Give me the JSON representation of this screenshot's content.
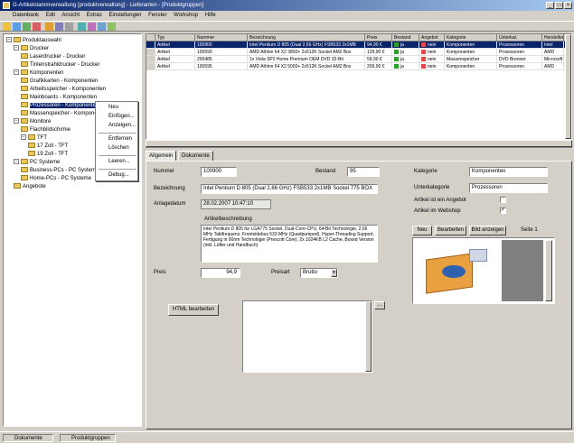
{
  "window": {
    "title": "G-Artikelstammverwaltung [produktverwaltung] - Lieferanten - [Produktgruppen]"
  },
  "menu": [
    "Datenbank",
    "Edit",
    "Ansicht",
    "Extras",
    "Einstellungen",
    "Fenster",
    "Workshop",
    "Hilfe"
  ],
  "tree": [
    {
      "label": "Produktauswahl",
      "level": 0,
      "expander": "−"
    },
    {
      "label": "Drucker",
      "level": 1,
      "expander": "−"
    },
    {
      "label": "Laserdrucker - Drucker",
      "level": 2
    },
    {
      "label": "Tintenstrahldrucker - Drucker",
      "level": 2
    },
    {
      "label": "Komponenten",
      "level": 1,
      "expander": "−"
    },
    {
      "label": "Grafikkarten - Komponenten",
      "level": 2
    },
    {
      "label": "Arbeitsspeicher - Komponenten",
      "level": 2
    },
    {
      "label": "Mainboards - Komponenten",
      "level": 2
    },
    {
      "label": "Prozessoren - Komponenten",
      "level": 2,
      "selected": true
    },
    {
      "label": "Massenspeicher - Komponenten",
      "level": 2
    },
    {
      "label": "Monitore",
      "level": 1,
      "expander": "−"
    },
    {
      "label": "Flachbildschirme",
      "level": 2
    },
    {
      "label": "TFT",
      "level": 2,
      "expander": "−"
    },
    {
      "label": "17 Zoll - TFT",
      "level": 3
    },
    {
      "label": "19 Zoll - TFT",
      "level": 3
    },
    {
      "label": "PC Systeme",
      "level": 1,
      "expander": "−"
    },
    {
      "label": "Business-PCs - PC Systeme",
      "level": 2
    },
    {
      "label": "Home-PCs - PC Systeme",
      "level": 2
    },
    {
      "label": "Angebote",
      "level": 1
    }
  ],
  "context_menu": [
    "Neu",
    "Einfügen...",
    "Anzeigen...",
    "Entfernen",
    "Löschen",
    "Leeren...",
    "Debug..."
  ],
  "grid": {
    "headers": [
      "Typ",
      "Nummer",
      "Bezeichnung",
      "Preis",
      "Bestand",
      "Angebot",
      "Kategorie",
      "Unterkat.",
      "Hersteller",
      "Verkauf"
    ],
    "rows": [
      [
        "Artikel",
        "100900",
        "Intel Pentium D 805 (Dual 2,66 GHz) FSB533 2x1MB",
        "94,90 €",
        "ja",
        "nein",
        "Komponenten",
        "Prozessoren",
        "Intel",
        "D"
      ],
      [
        "Artikel",
        "100590",
        "AMD Athlon 64 X2 3800+ 2x512K Sockel AM2 Box",
        "129,90 €",
        "ja",
        "nein",
        "Komponenten",
        "Prozessoren",
        "AMD",
        "D"
      ],
      [
        "Artikel",
        "200485",
        "1x Vista SP2 Home Premium OEM DVD 32-Bit",
        "59,90 €",
        "ja",
        "nein",
        "Massenspeicher",
        "DVD Brenner",
        "Microsoft",
        "D"
      ],
      [
        "Artikel",
        "100595",
        "AMD Athlon 64 X2 5000+ 2x512K Sockel AM2 Box",
        "209,90 €",
        "ja",
        "nein",
        "Komponenten",
        "Prozessoren",
        "AMD",
        "D"
      ]
    ]
  },
  "tabs": [
    "Allgemein",
    "Dokumente"
  ],
  "detail": {
    "nummer_label": "Nummer",
    "nummer": "100900",
    "bestand_label": "Bestand",
    "bestand": "95",
    "bezeichnung_label": "Bezeichnung",
    "bezeichnung": "Intel Pentium D 805 (Dual 2,66 GHz) FSB533 2x1MB Sockel 775 BOX",
    "anlage_label": "Anlagedatum",
    "anlage": "28.02.2007 10:47:10",
    "beschreibung_label": "Artikelbeschreibung",
    "beschreibung": "Intel Pentium D 805 für LGA775 Sockel, Dual-Core-CPU, 64-Bit Technologie, 2,66 MHz Taktfrequenz, Frontsidebus 533 MHz (Quadpumped), Hyper-Threading Support, Fertigung in 90nm Technologie (Prescott Core), 2x 1024KB L2 Cache, Boxed Version (inkl. Lüfter und Handbuch)",
    "preis_label": "Preis",
    "preis": "94,9",
    "preisart_label": "Preisart",
    "preisart": "Brutto",
    "kategorie_label": "Kategorie",
    "kategorie": "Komponenten",
    "unterkategorie_label": "Unterkategorie",
    "unterkategorie": "Prozessoren",
    "angebot_label": "Artikel ist ein Angebot",
    "angebot": false,
    "verkauf_label": "Artikel im Webshop",
    "verkauf": true,
    "html_button": "HTML bearbeiten",
    "bild_buttons": [
      "Neu",
      "Bearbeiten",
      "Bild anzeigen"
    ],
    "seite": "Seite 1"
  },
  "status": [
    "Dokumente",
    "Produktgruppen"
  ],
  "colors": {
    "title_start": "#0a246a",
    "title_end": "#a6caf0",
    "selection": "#0a246a",
    "badge_green": "#2aa02a",
    "badge_red": "#e24a4a"
  }
}
